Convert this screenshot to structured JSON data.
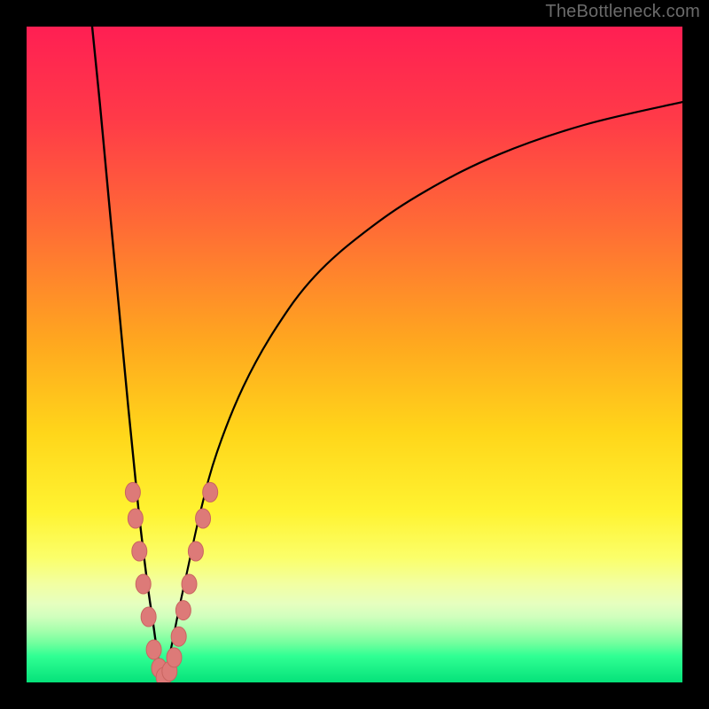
{
  "watermark": "TheBottleneck.com",
  "colors": {
    "frame": "#000000",
    "curve_stroke": "#000000",
    "marker_fill": "#dd7a78",
    "marker_stroke": "#c96460",
    "gradient_stops": [
      {
        "offset": "0%",
        "color": "#ff1f53"
      },
      {
        "offset": "14%",
        "color": "#ff3a48"
      },
      {
        "offset": "30%",
        "color": "#ff6a36"
      },
      {
        "offset": "48%",
        "color": "#ffa71f"
      },
      {
        "offset": "62%",
        "color": "#ffd61a"
      },
      {
        "offset": "74%",
        "color": "#fff331"
      },
      {
        "offset": "81%",
        "color": "#fbff6a"
      },
      {
        "offset": "85%",
        "color": "#f2ffa2"
      },
      {
        "offset": "88%",
        "color": "#e6ffbf"
      },
      {
        "offset": "90%",
        "color": "#d0ffbd"
      },
      {
        "offset": "92%",
        "color": "#a7ffad"
      },
      {
        "offset": "94%",
        "color": "#72ff9e"
      },
      {
        "offset": "96%",
        "color": "#30ff93"
      },
      {
        "offset": "100%",
        "color": "#05e27a"
      }
    ]
  },
  "chart_data": {
    "type": "line",
    "title": "",
    "xlabel": "",
    "ylabel": "",
    "xlim": [
      0,
      100
    ],
    "ylim": [
      0,
      100
    ],
    "series": [
      {
        "name": "left-curve",
        "x": [
          10.0,
          11.2,
          12.5,
          14.0,
          15.5,
          17.0,
          18.3,
          19.3,
          20.0,
          20.5,
          20.8
        ],
        "y": [
          100.0,
          88.0,
          74.0,
          58.0,
          42.0,
          27.0,
          16.0,
          9.0,
          4.0,
          1.5,
          0.0
        ]
      },
      {
        "name": "right-curve",
        "x": [
          20.8,
          21.3,
          22.2,
          23.2,
          24.5,
          26.5,
          29.0,
          33.0,
          38.0,
          44.0,
          52.0,
          61.0,
          72.0,
          85.0,
          100.0
        ],
        "y": [
          0.0,
          2.0,
          6.0,
          11.0,
          17.0,
          26.0,
          35.0,
          45.0,
          54.0,
          62.0,
          69.0,
          75.0,
          80.5,
          85.0,
          88.5
        ]
      }
    ],
    "markers": [
      {
        "x": 16.2,
        "y": 29.0
      },
      {
        "x": 16.6,
        "y": 25.0
      },
      {
        "x": 17.2,
        "y": 20.0
      },
      {
        "x": 17.8,
        "y": 15.0
      },
      {
        "x": 18.6,
        "y": 10.0
      },
      {
        "x": 19.4,
        "y": 5.0
      },
      {
        "x": 20.2,
        "y": 2.2
      },
      {
        "x": 20.9,
        "y": 0.8
      },
      {
        "x": 21.8,
        "y": 1.7
      },
      {
        "x": 22.5,
        "y": 3.8
      },
      {
        "x": 23.2,
        "y": 7.0
      },
      {
        "x": 23.9,
        "y": 11.0
      },
      {
        "x": 24.8,
        "y": 15.0
      },
      {
        "x": 25.8,
        "y": 20.0
      },
      {
        "x": 26.9,
        "y": 25.0
      },
      {
        "x": 28.0,
        "y": 29.0
      }
    ]
  }
}
